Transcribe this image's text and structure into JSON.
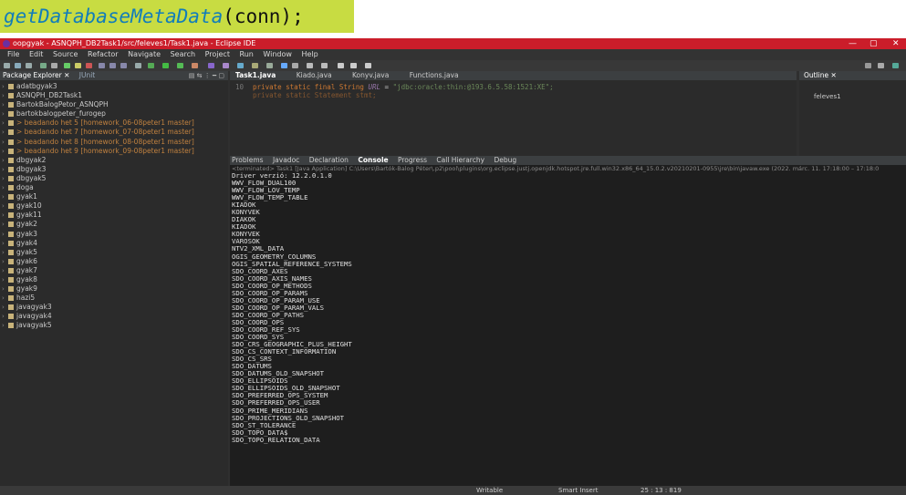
{
  "caption": {
    "method": "getDatabaseMetaData",
    "rest": "(conn);"
  },
  "window": {
    "title": "oopgyak - ASNQPH_DB2Task1/src/feleves1/Task1.java - Eclipse IDE",
    "controls": [
      "—",
      "▢",
      "✕"
    ]
  },
  "menu": [
    "File",
    "Edit",
    "Source",
    "Refactor",
    "Navigate",
    "Search",
    "Project",
    "Run",
    "Window",
    "Help"
  ],
  "package_explorer": {
    "tab": "Package Explorer",
    "tab2": "JUnit",
    "items": [
      {
        "label": "adatbgyak3",
        "git": false
      },
      {
        "label": "ASNQPH_DB2Task1",
        "git": false
      },
      {
        "label": "BartokBalogPetor_ASNQPH",
        "git": false
      },
      {
        "label": "bartokbalogpeter_furogep",
        "git": false
      },
      {
        "label": "> beadando het 5 [homework_06-08peter1 master]",
        "git": true
      },
      {
        "label": "> beadando het 7 [homework_07-08peter1 master]",
        "git": true
      },
      {
        "label": "> beadando het 8 [homework_08-08peter1 master]",
        "git": true
      },
      {
        "label": "> beadando het 9 [homework_09-08peter1 master]",
        "git": true
      },
      {
        "label": "dbgyak2",
        "git": false
      },
      {
        "label": "dbgyak3",
        "git": false
      },
      {
        "label": "dbgyak5",
        "git": false
      },
      {
        "label": "doga",
        "git": false
      },
      {
        "label": "gyak1",
        "git": false
      },
      {
        "label": "gyak10",
        "git": false
      },
      {
        "label": "gyak11",
        "git": false
      },
      {
        "label": "gyak2",
        "git": false
      },
      {
        "label": "gyak3",
        "git": false
      },
      {
        "label": "gyak4",
        "git": false
      },
      {
        "label": "gyak5",
        "git": false
      },
      {
        "label": "gyak6",
        "git": false
      },
      {
        "label": "gyak7",
        "git": false
      },
      {
        "label": "gyak8",
        "git": false
      },
      {
        "label": "gyak9",
        "git": false
      },
      {
        "label": "hazi5",
        "git": false
      },
      {
        "label": "javagyak3",
        "git": false
      },
      {
        "label": "javagyak4",
        "git": false
      },
      {
        "label": "javagyak5",
        "git": false
      }
    ]
  },
  "editor": {
    "tabs": [
      "Task1.java",
      "Kiado.java",
      "Konyv.java",
      "Functions.java"
    ],
    "line_no": "10",
    "code_kw": "private static final String ",
    "code_var": "URL",
    "code_eq": " = ",
    "code_str": "\"jdbc:oracle:thin:@193.6.5.58:1521:XE\";",
    "line2": "private static Statement stmt;"
  },
  "outline": {
    "tab": "Outline",
    "item": "feleves1"
  },
  "console": {
    "tabs": [
      "Problems",
      "Javadoc",
      "Declaration",
      "Console",
      "Progress",
      "Call Hierarchy",
      "Debug"
    ],
    "status": "<terminated> Task1 [Java Application] C:\\Users\\Bartók-Balog Péter\\.p2\\pool\\plugins\\org.eclipse.justj.openjdk.hotspot.jre.full.win32.x86_64_15.0.2.v20210201-0955\\jre\\bin\\javaw.exe (2022. márc. 11. 17:18:00 – 17:18:0",
    "lines": [
      "Driver verzió: 12.2.0.1.0",
      "WWV_FLOW_DUAL100",
      "WWV_FLOW_LOV_TEMP",
      "WWV_FLOW_TEMP_TABLE",
      "KIADOK",
      "KONYVEK",
      "DIAKOK",
      "KIADOK",
      "KONYVEK",
      "VAROSOK",
      "NTV2_XML_DATA",
      "OGIS_GEOMETRY_COLUMNS",
      "OGIS_SPATIAL_REFERENCE_SYSTEMS",
      "SDO_COORD_AXES",
      "SDO_COORD_AXIS_NAMES",
      "SDO_COORD_OP_METHODS",
      "SDO_COORD_OP_PARAMS",
      "SDO_COORD_OP_PARAM_USE",
      "SDO_COORD_OP_PARAM_VALS",
      "SDO_COORD_OP_PATHS",
      "SDO_COORD_OPS",
      "SDO_COORD_REF_SYS",
      "SDO_COORD_SYS",
      "SDO_CRS_GEOGRAPHIC_PLUS_HEIGHT",
      "SDO_CS_CONTEXT_INFORMATION",
      "SDO_CS_SRS",
      "SDO_DATUMS",
      "SDO_DATUMS_OLD_SNAPSHOT",
      "SDO_ELLIPSOIDS",
      "SDO_ELLIPSOIDS_OLD_SNAPSHOT",
      "SDO_PREFERRED_OPS_SYSTEM",
      "SDO_PREFERRED_OPS_USER",
      "SDO_PRIME_MERIDIANS",
      "SDO_PROJECTIONS_OLD_SNAPSHOT",
      "SDO_ST_TOLERANCE",
      "SDO_TOPO_DATA$",
      "SDO_TOPO_RELATION_DATA"
    ]
  },
  "statusbar": {
    "writable": "Writable",
    "insert": "Smart Insert",
    "position": "25 : 13 : 819"
  }
}
